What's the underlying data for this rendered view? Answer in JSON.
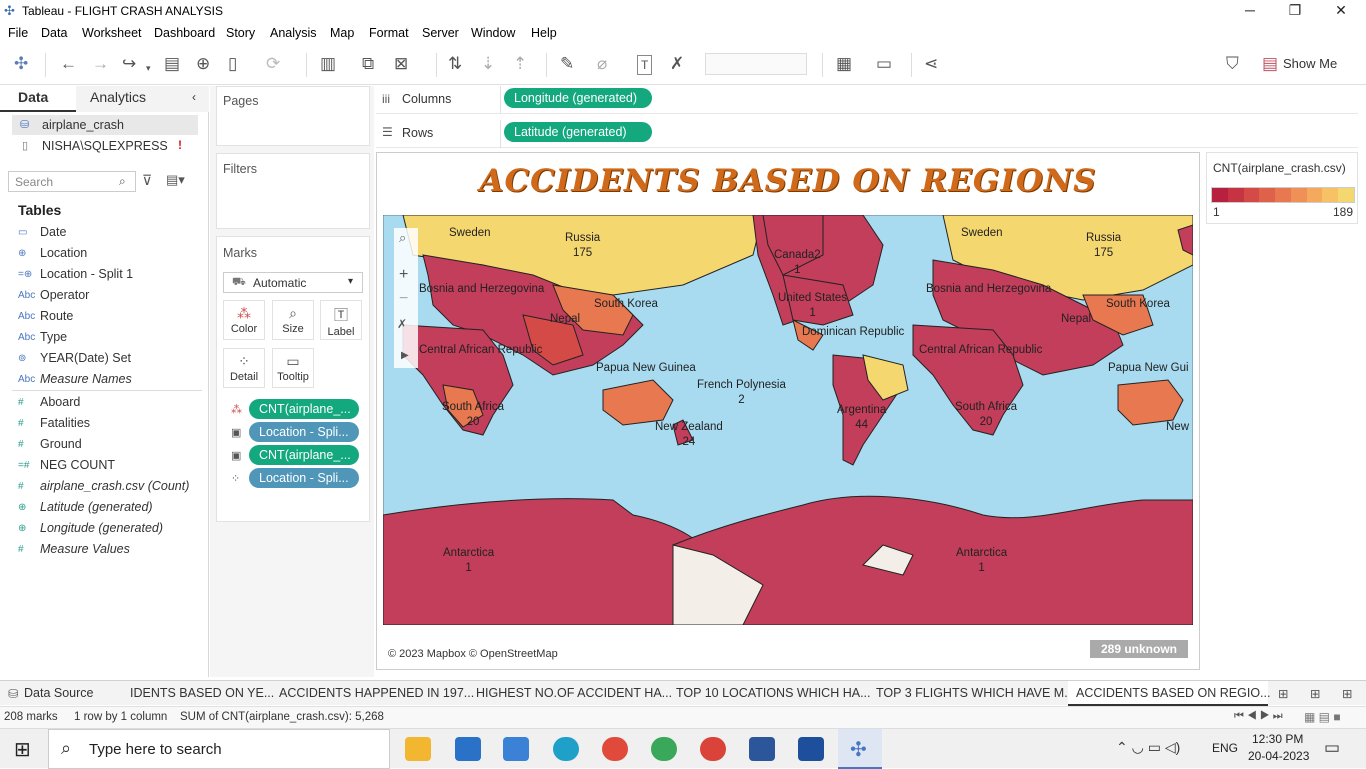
{
  "window": {
    "title": "Tableau - FLIGHT CRASH ANALYSIS",
    "minimize": "─",
    "restore": "❐",
    "close": "✕"
  },
  "menu": [
    "File",
    "Data",
    "Worksheet",
    "Dashboard",
    "Story",
    "Analysis",
    "Map",
    "Format",
    "Server",
    "Window",
    "Help"
  ],
  "toolbar": {
    "show_me": "Show Me"
  },
  "left": {
    "tab_data": "Data",
    "tab_analytics": "Analytics",
    "sources": [
      {
        "label": "airplane_crash",
        "icon": "datasource-icon"
      },
      {
        "label": "NISHA\\SQLEXPRESS",
        "icon": "database-icon",
        "warn": "!"
      }
    ],
    "search_placeholder": "Search",
    "tables_heading": "Tables",
    "dimensions": [
      {
        "label": "Date",
        "type": "▭"
      },
      {
        "label": "Location",
        "type": "⊕"
      },
      {
        "label": "Location - Split 1",
        "type": "=⊕"
      },
      {
        "label": "Operator",
        "type": "Abc"
      },
      {
        "label": "Route",
        "type": "Abc"
      },
      {
        "label": "Type",
        "type": "Abc"
      },
      {
        "label": "YEAR(Date) Set",
        "type": "⊚"
      },
      {
        "label": "Measure Names",
        "type": "Abc"
      }
    ],
    "measures": [
      {
        "label": "Aboard",
        "type": "#"
      },
      {
        "label": "Fatalities",
        "type": "#"
      },
      {
        "label": "Ground",
        "type": "#"
      },
      {
        "label": "NEG COUNT",
        "type": "=#"
      },
      {
        "label": "airplane_crash.csv (Count)",
        "type": "#"
      },
      {
        "label": "Latitude (generated)",
        "type": "⊕"
      },
      {
        "label": "Longitude (generated)",
        "type": "⊕"
      },
      {
        "label": "Measure Values",
        "type": "#"
      }
    ]
  },
  "cards": {
    "pages": "Pages",
    "filters": "Filters",
    "marks": "Marks",
    "mark_type": "Automatic",
    "buttons": [
      "Color",
      "Size",
      "Label",
      "Detail",
      "Tooltip"
    ],
    "pills": [
      {
        "label": "CNT(airplane_...",
        "icon": "color-icon",
        "color": "green"
      },
      {
        "label": "Location - Spli...",
        "icon": "label-icon",
        "color": "blue"
      },
      {
        "label": "CNT(airplane_...",
        "icon": "label-icon",
        "color": "green"
      },
      {
        "label": "Location - Spli...",
        "icon": "detail-icon",
        "color": "blue"
      }
    ]
  },
  "shelves": {
    "columns_label": "Columns",
    "columns_pill": "Longitude (generated)",
    "rows_label": "Rows",
    "rows_pill": "Latitude (generated)"
  },
  "view": {
    "title": "ACCIDENTS BASED ON REGIONS",
    "attribution": "© 2023 Mapbox © OpenStreetMap",
    "unknown": "289 unknown",
    "labels": [
      {
        "name": "Russia",
        "value": "175"
      },
      {
        "name": "Canada2",
        "value": "1"
      },
      {
        "name": "United States",
        "value": "1"
      },
      {
        "name": "Dominican Republic",
        "value": ""
      },
      {
        "name": "South Korea",
        "value": ""
      },
      {
        "name": "Nepal",
        "value": ""
      },
      {
        "name": "Papua New Guinea",
        "value": ""
      },
      {
        "name": "French Polynesia",
        "value": "2"
      },
      {
        "name": "New Zealand",
        "value": "24"
      },
      {
        "name": "Argentina",
        "value": "44"
      },
      {
        "name": "South Africa",
        "value": "20"
      },
      {
        "name": "Antarctica",
        "value": "1"
      },
      {
        "name": "Bosnia and Herzegovina",
        "value": ""
      },
      {
        "name": "Central African Republic",
        "value": ""
      },
      {
        "name": "Sweden",
        "value": ""
      },
      {
        "name": "Russia",
        "value": "175"
      },
      {
        "name": "South Korea",
        "value": ""
      },
      {
        "name": "Nepal",
        "value": ""
      },
      {
        "name": "Central African Republic",
        "value": ""
      },
      {
        "name": "Papua New Gui",
        "value": ""
      },
      {
        "name": "South Africa",
        "value": "20"
      },
      {
        "name": "New",
        "value": ""
      },
      {
        "name": "Antarctica",
        "value": "1"
      },
      {
        "name": "Bosnia and Herzegovina",
        "value": ""
      },
      {
        "name": "Sweden",
        "value": ""
      }
    ]
  },
  "legend": {
    "title": "CNT(airplane_crash.csv)",
    "min": "1",
    "max": "189",
    "colors": [
      "#b8203f",
      "#c63343",
      "#d44a46",
      "#de614a",
      "#e8784f",
      "#ef9156",
      "#f4a95d",
      "#f7c265",
      "#f5d770"
    ]
  },
  "sheet_tabs": [
    "Data Source",
    "IDENTS BASED ON YE...",
    "ACCIDENTS HAPPENED IN 197...",
    "HIGHEST NO.OF ACCIDENT HA...",
    "TOP 10 LOCATIONS WHICH HA...",
    "TOP 3 FLIGHTS WHICH HAVE M...",
    "ACCIDENTS BASED ON REGIO..."
  ],
  "status": {
    "marks": "208 marks",
    "grid": "1 row by 1 column",
    "sum": "SUM of CNT(airplane_crash.csv): 5,268"
  },
  "taskbar": {
    "search": "Type here to search",
    "lang": "ENG",
    "time": "12:30 PM",
    "date": "20-04-2023"
  }
}
